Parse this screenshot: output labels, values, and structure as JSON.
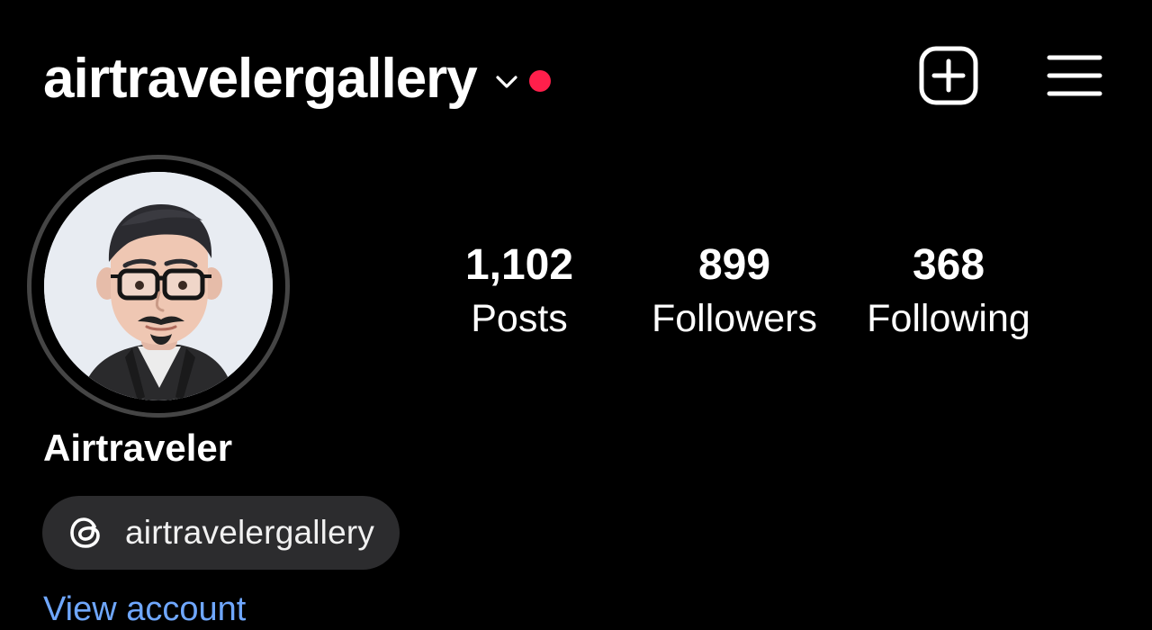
{
  "header": {
    "username": "airtravelergallery",
    "chevron_icon": "chevron-down-icon",
    "notification_dot_color": "#ff1f4b",
    "add_icon": "plus-square-icon",
    "menu_icon": "hamburger-menu-icon"
  },
  "profile": {
    "avatar_icon": "memoji-avatar",
    "display_name": "Airtraveler",
    "threads": {
      "icon": "threads-icon",
      "handle": "airtravelergallery"
    },
    "cut_link": "View account"
  },
  "stats": [
    {
      "value": "1,102",
      "label": "Posts"
    },
    {
      "value": "899",
      "label": "Followers"
    },
    {
      "value": "368",
      "label": "Following"
    }
  ],
  "colors": {
    "background": "#000000",
    "text": "#ffffff",
    "pill_background": "#2c2c2e",
    "link": "#6fa7ff"
  }
}
